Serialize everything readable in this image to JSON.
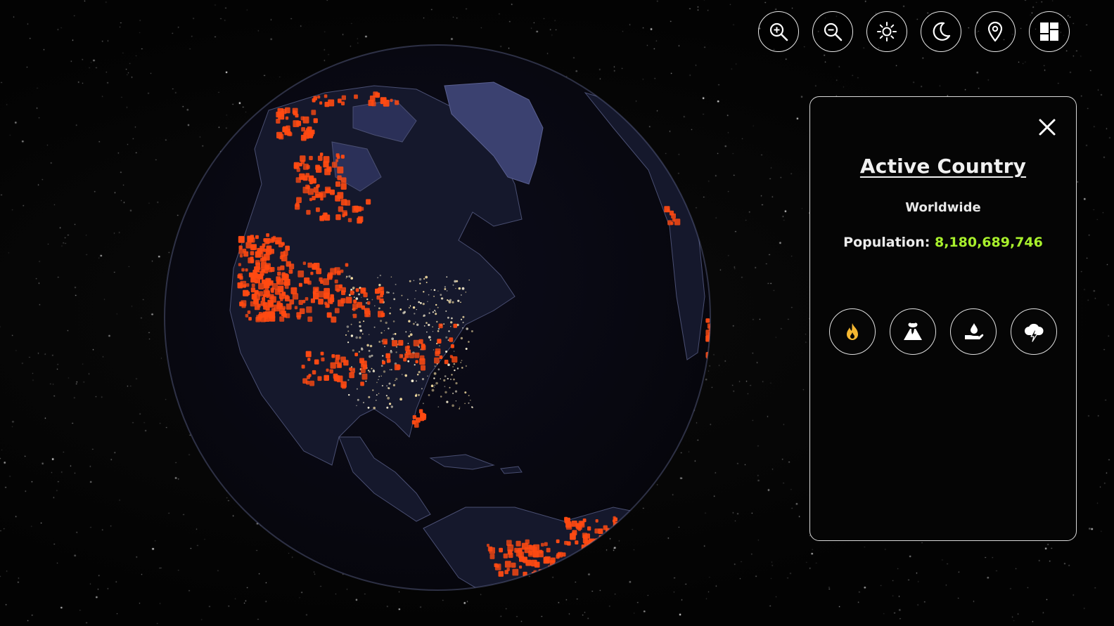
{
  "toolbar": {
    "buttons": [
      {
        "name": "zoom-in-button",
        "icon": "zoom-in-icon"
      },
      {
        "name": "zoom-out-button",
        "icon": "zoom-out-icon"
      },
      {
        "name": "light-mode-button",
        "icon": "sun-icon"
      },
      {
        "name": "dark-mode-button",
        "icon": "moon-icon"
      },
      {
        "name": "location-button",
        "icon": "map-pin-icon"
      },
      {
        "name": "dashboard-button",
        "icon": "dashboard-grid-icon"
      }
    ]
  },
  "panel": {
    "title": "Active Country",
    "region": "Worldwide",
    "population_label": "Population:",
    "population_value": "8,180,689,746",
    "close_icon": "close-icon",
    "categories": [
      {
        "name": "wildfire-button",
        "icon": "fire-icon",
        "color": "#f5b731"
      },
      {
        "name": "volcano-button",
        "icon": "volcano-icon",
        "color": "#ffffff"
      },
      {
        "name": "flood-button",
        "icon": "water-hand-icon",
        "color": "#ffffff"
      },
      {
        "name": "storm-button",
        "icon": "storm-cloud-icon",
        "color": "#ffffff"
      }
    ]
  },
  "globe": {
    "event_color": "#ff4a12",
    "ocean_color": "#0a0a16",
    "land_color": "#14162a",
    "ice_color": "#3a3f66"
  }
}
